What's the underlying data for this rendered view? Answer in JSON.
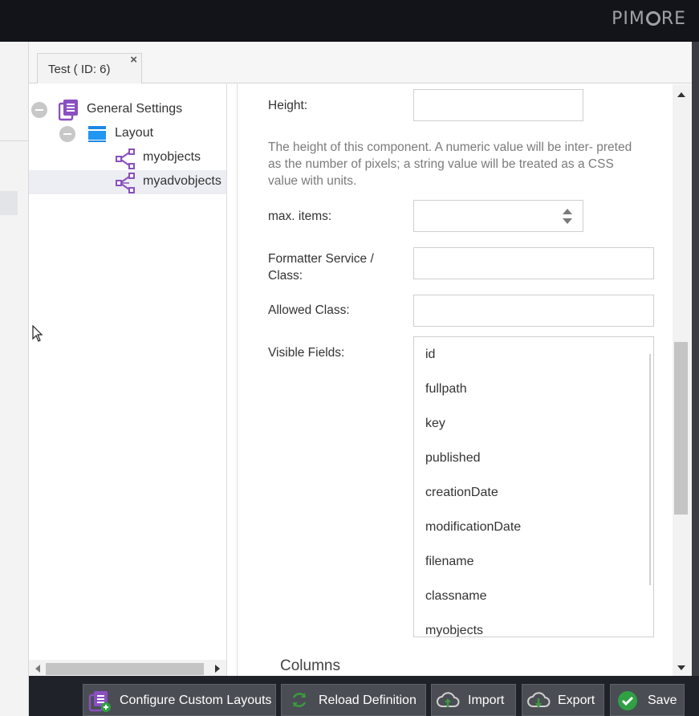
{
  "app": {
    "logo_prefix": "PIM",
    "logo_suffix": "RE"
  },
  "tab": {
    "label": "Test ( ID: 6)",
    "close_glyph": "×"
  },
  "tree": {
    "nodes": [
      {
        "label": "General Settings",
        "icon": "class-settings-icon"
      },
      {
        "label": "Layout",
        "icon": "layout-panel-icon"
      },
      {
        "label": "myobjects",
        "icon": "relation-icon"
      },
      {
        "label": "myadvobjects",
        "icon": "advanced-relation-icon",
        "selected": true
      }
    ]
  },
  "form": {
    "height_label": "Height:",
    "height_value": "",
    "height_help": "The height of this component. A numeric value will be inter- preted as the number of pixels; a string value will be treated as a CSS value with units.",
    "max_items_label": "max. items:",
    "max_items_value": "",
    "formatter_label_line1": "Formatter Service /",
    "formatter_label_line2": "Class:",
    "formatter_value": "",
    "allowed_class_label": "Allowed Class:",
    "allowed_class_value": "",
    "visible_fields_label": "Visible Fields:",
    "visible_fields": [
      "id",
      "fullpath",
      "key",
      "published",
      "creationDate",
      "modificationDate",
      "filename",
      "classname",
      "myobjects"
    ],
    "columns_title": "Columns"
  },
  "toolbar": {
    "configure_custom_layouts": "Configure Custom Layouts",
    "reload_definition": "Reload Definition",
    "import": "Import",
    "export": "Export",
    "save": "Save"
  },
  "colors": {
    "topbar": "#121419",
    "accent_purple": "#8a4fc0",
    "save_green": "#2fa043",
    "reload_green": "#3c9a3c"
  }
}
